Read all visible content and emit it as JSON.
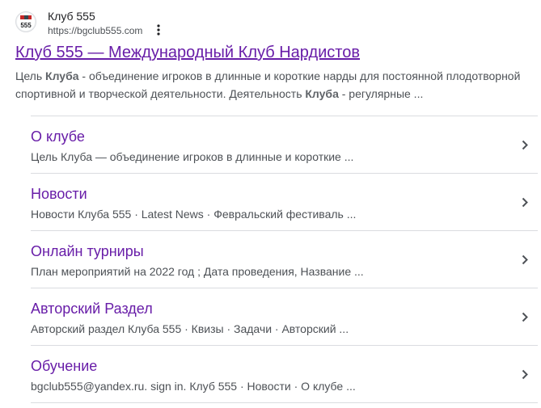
{
  "result": {
    "favicon_icon": "club-555-logo",
    "favicon_text": "555",
    "site_name": "Клуб 555",
    "url": "https://bgclub555.com",
    "title": "Клуб 555 — Международный Клуб Нардистов",
    "snippet": {
      "part1": "Цель ",
      "bold1": "Клуба",
      "part2": " - объединение игроков в длинные и короткие нарды для постоянной плодотворной спортивной и творческой деятельности. Деятельность ",
      "bold2": "Клуба",
      "part3": " - регулярные ..."
    }
  },
  "sitelinks": [
    {
      "title": "О клубе",
      "desc": "Цель Клуба — объединение игроков в длинные и короткие ..."
    },
    {
      "title": "Новости",
      "desc": "Новости Клуба 555 · Latest News · Февральский фестиваль ..."
    },
    {
      "title": "Онлайн турниры",
      "desc": "План мероприятий на 2022 год ; Дата проведения, Название ..."
    },
    {
      "title": "Авторский Раздел",
      "desc": "Авторский раздел Клуба 555 · Квизы · Задачи · Авторский ..."
    },
    {
      "title": "Обучение",
      "desc": "bgclub555@yandex.ru. sign in. Клуб 555 · Новости · О клубе ..."
    }
  ],
  "colors": {
    "visited_link": "#681da8",
    "snippet_text": "#4d5156",
    "divider": "#dadce0"
  },
  "icons": {
    "more": "more-vertical-icon",
    "chevron": "chevron-right-icon"
  }
}
